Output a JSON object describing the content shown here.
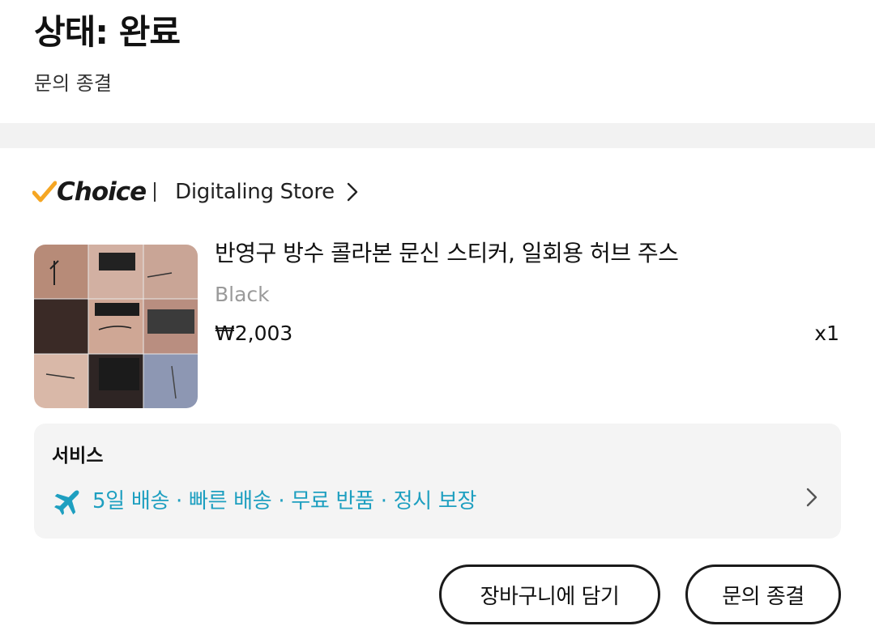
{
  "status": {
    "title": "상태: 완료",
    "subtitle": "문의 종결"
  },
  "store": {
    "badge": "Choice",
    "name": "Digitaling Store"
  },
  "product": {
    "title": "반영구 방수 콜라본 문신 스티커, 일회용 허브 주스",
    "variant": "Black",
    "price": "₩2,003",
    "quantity": "x1",
    "image": "product-thumbnail"
  },
  "service": {
    "heading": "서비스",
    "details": "5일 배송 · 빠른 배송 · 무료 반품 · 정시 보장"
  },
  "actions": {
    "add_to_cart": "장바구니에 담기",
    "close_inquiry": "문의 종결"
  },
  "colors": {
    "accent_blue": "#1e9fc0",
    "choice_check": "#f5a623",
    "band": "#f2f2f2",
    "service_bg": "#f4f4f4"
  }
}
